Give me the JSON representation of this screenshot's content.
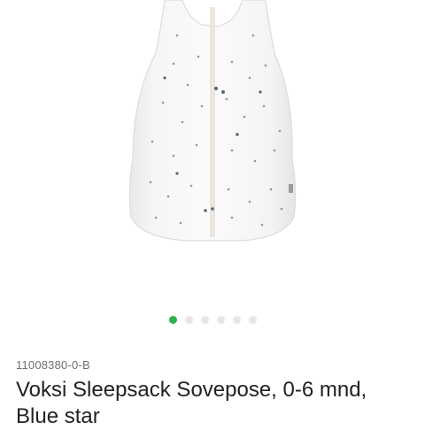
{
  "product": {
    "image": {
      "icon": "sleepsack-image"
    },
    "carousel": {
      "slide_count": 6,
      "active_index": 0,
      "active_color": "#2fb24a",
      "inactive_color": "#e7e7e7"
    },
    "sku": "11008380-0-B",
    "title": "Voksi Sleepsack Sovepose, 0-6 mnd, Blue star"
  }
}
